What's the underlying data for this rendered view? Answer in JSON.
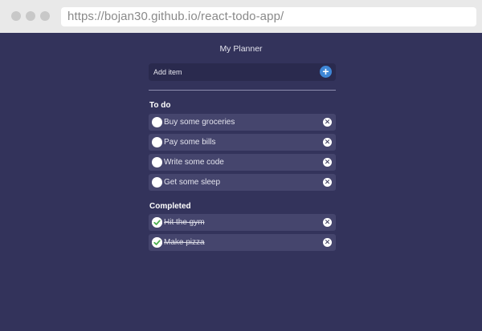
{
  "browser": {
    "url": "https://bojan30.github.io/react-todo-app/"
  },
  "app": {
    "title": "My Planner",
    "add_input_value": "Add item",
    "add_button_icon": "plus-icon",
    "todo_heading": "To do",
    "completed_heading": "Completed",
    "todo_items": [
      {
        "label": "Buy some groceries"
      },
      {
        "label": "Pay some bills"
      },
      {
        "label": "Write some code"
      },
      {
        "label": "Get some sleep"
      }
    ],
    "completed_items": [
      {
        "label": "Hit the gym"
      },
      {
        "label": "Make pizza"
      }
    ],
    "colors": {
      "background": "#33335b",
      "item": "#45456d",
      "accent": "#3f87d6",
      "check": "#4cae4c"
    }
  }
}
